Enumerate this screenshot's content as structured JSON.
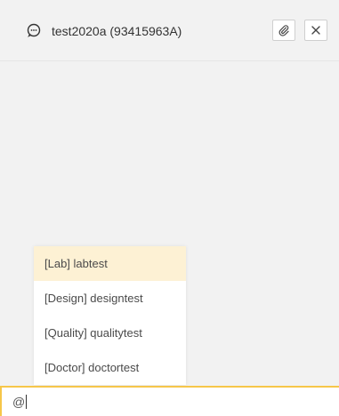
{
  "header": {
    "title": "test2020a (93415963A)",
    "icons": {
      "chat": "chat-bubble-icon",
      "attach": "paperclip-icon",
      "close": "close-icon"
    }
  },
  "mention_menu": {
    "items": [
      {
        "label": "[Lab] labtest",
        "active": true
      },
      {
        "label": "[Design] designtest",
        "active": false
      },
      {
        "label": "[Quality] qualitytest",
        "active": false
      },
      {
        "label": "[Doctor] doctortest",
        "active": false
      }
    ]
  },
  "input": {
    "value": "@"
  },
  "colors": {
    "accent": "#f6c64a",
    "highlight": "#fdf1d4",
    "background": "#f2f2f2"
  }
}
